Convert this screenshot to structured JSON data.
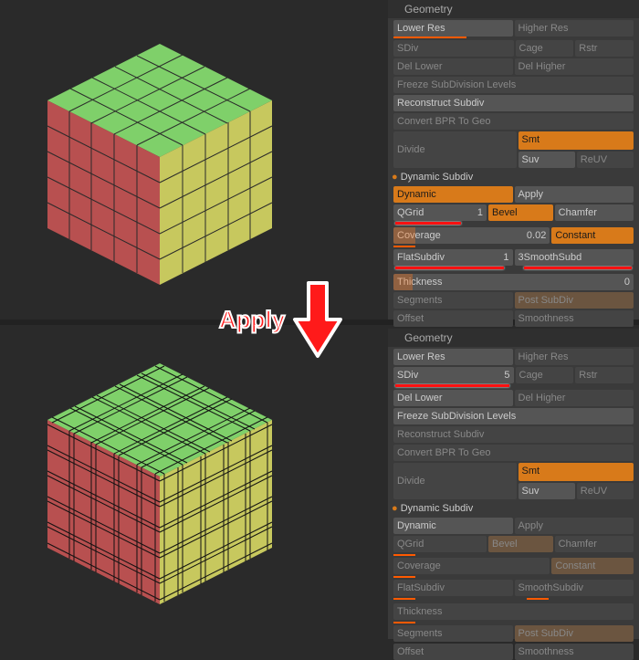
{
  "apply_label": "Apply",
  "panel_top": {
    "header": "Geometry",
    "lowerRes": "Lower Res",
    "higherRes": "Higher Res",
    "sdiv": "SDiv",
    "cage": "Cage",
    "rstr": "Rstr",
    "delLower": "Del Lower",
    "delHigher": "Del Higher",
    "freeze": "Freeze SubDivision Levels",
    "reconstruct": "Reconstruct Subdiv",
    "convertBPR": "Convert BPR To Geo",
    "divide": "Divide",
    "smt": "Smt",
    "suv": "Suv",
    "reuv": "ReUV",
    "dynSect": "Dynamic Subdiv",
    "dynamic": "Dynamic",
    "apply": "Apply",
    "qgrid": "QGrid",
    "qgrid_val": "1",
    "bevel": "Bevel",
    "chamfer": "Chamfer",
    "coverage": "Coverage",
    "coverage_val": "0.02",
    "constant": "Constant",
    "flatSubdiv": "FlatSubdiv",
    "flat_val": "1",
    "smoothSubdiv": "SmoothSubd",
    "smooth_val": "3",
    "thickness": "Thickness",
    "thickness_val": "0",
    "segments": "Segments",
    "postSubdiv": "Post SubDiv",
    "offset": "Offset",
    "smoothness": "Smoothness"
  },
  "panel_bot": {
    "header": "Geometry",
    "lowerRes": "Lower Res",
    "higherRes": "Higher Res",
    "sdiv": "SDiv",
    "sdiv_val": "5",
    "cage": "Cage",
    "rstr": "Rstr",
    "delLower": "Del Lower",
    "delHigher": "Del Higher",
    "freeze": "Freeze SubDivision Levels",
    "reconstruct": "Reconstruct Subdiv",
    "convertBPR": "Convert BPR To Geo",
    "divide": "Divide",
    "smt": "Smt",
    "suv": "Suv",
    "reuv": "ReUV",
    "dynSect": "Dynamic Subdiv",
    "dynamic": "Dynamic",
    "apply": "Apply",
    "qgrid": "QGrid",
    "bevel": "Bevel",
    "chamfer": "Chamfer",
    "coverage": "Coverage",
    "constant": "Constant",
    "flatSubdiv": "FlatSubdiv",
    "smoothSubdiv": "SmoothSubdiv",
    "thickness": "Thickness",
    "segments": "Segments",
    "postSubdiv": "Post SubDiv",
    "offset": "Offset",
    "smoothness": "Smoothness"
  }
}
